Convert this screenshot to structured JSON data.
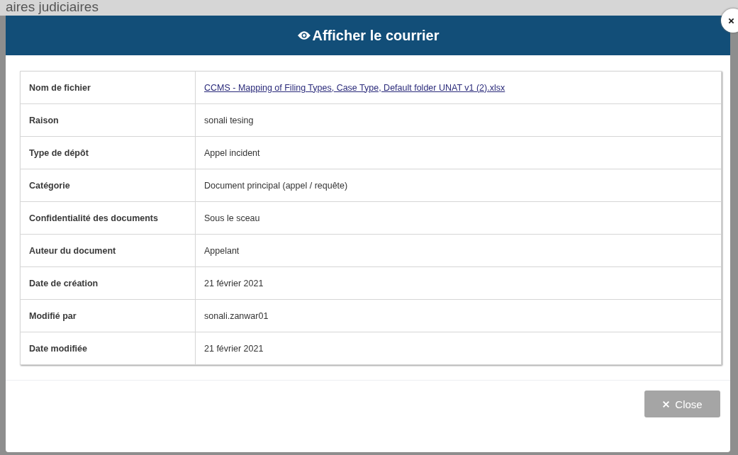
{
  "background": {
    "title": "aires judiciaires"
  },
  "dialog": {
    "title": "Afficher le courrier"
  },
  "details": [
    {
      "label": "Nom de fichier",
      "value": "CCMS - Mapping of Filing Types, Case Type, Default folder UNAT v1 (2).xlsx",
      "kind": "link"
    },
    {
      "label": "Raison",
      "value": "sonali tesing",
      "kind": "text"
    },
    {
      "label": "Type de dépôt",
      "value": "Appel incident",
      "kind": "text"
    },
    {
      "label": "Catégorie",
      "value": "Document principal (appel / requête)",
      "kind": "text"
    },
    {
      "label": "Confidentialité des documents",
      "value": "Sous le sceau",
      "kind": "text"
    },
    {
      "label": "Auteur du document",
      "value": "Appelant",
      "kind": "text"
    },
    {
      "label": "Date de création",
      "value": "21 février 2021",
      "kind": "text"
    },
    {
      "label": "Modifié par",
      "value": "sonali.zanwar01",
      "kind": "text"
    },
    {
      "label": "Date modifiée",
      "value": "21 février 2021",
      "kind": "text"
    }
  ],
  "footer": {
    "close_button": "Close"
  }
}
